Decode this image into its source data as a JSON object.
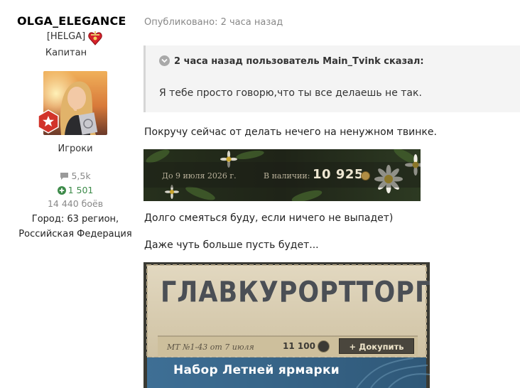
{
  "author": {
    "name": "OLGA_ELEGANCE",
    "clan_tag": "[HELGA]",
    "rank": "Капитан",
    "group": "Игроки",
    "posts": "5,5k",
    "reputation": "1 501",
    "battles": "14 440 боёв",
    "city_line1": "Город: 63 регион,",
    "city_line2": "Российская Федерация"
  },
  "post": {
    "published": "Опубликовано: 2 часа назад",
    "quote_header": "2 часа назад пользователь Main_Tvink сказал:",
    "quote_text": "Я тебе просто говорю,что ты все делаешь не так.",
    "paragraph1": "Покручу сейчас от делать нечего на ненужном твинке.",
    "paragraph2": "Долго смеяться буду, если ничего не выпадет)",
    "paragraph3": "Даже чуть больше пусть будет..."
  },
  "banner1": {
    "date": "До 9 июля 2026 г.",
    "available_label": "В наличии:",
    "amount": "10 925"
  },
  "banner2": {
    "title": "ГЛАВКУРОРТТОРГ",
    "code": "МТ №1-43 от 7 июля",
    "price": "11 100",
    "buy_button": "+ Докупить",
    "subtitle": "Набор Летней ярмарки"
  },
  "colors": {
    "reputation_green": "#3d8b4a",
    "muted_gray": "#888888",
    "quote_bg": "#f4f4f4"
  },
  "icons": [
    "heart-badge-icon",
    "star-badge-icon",
    "comment-icon",
    "plus-circle-icon",
    "chevron-down-icon",
    "coin-icon"
  ]
}
